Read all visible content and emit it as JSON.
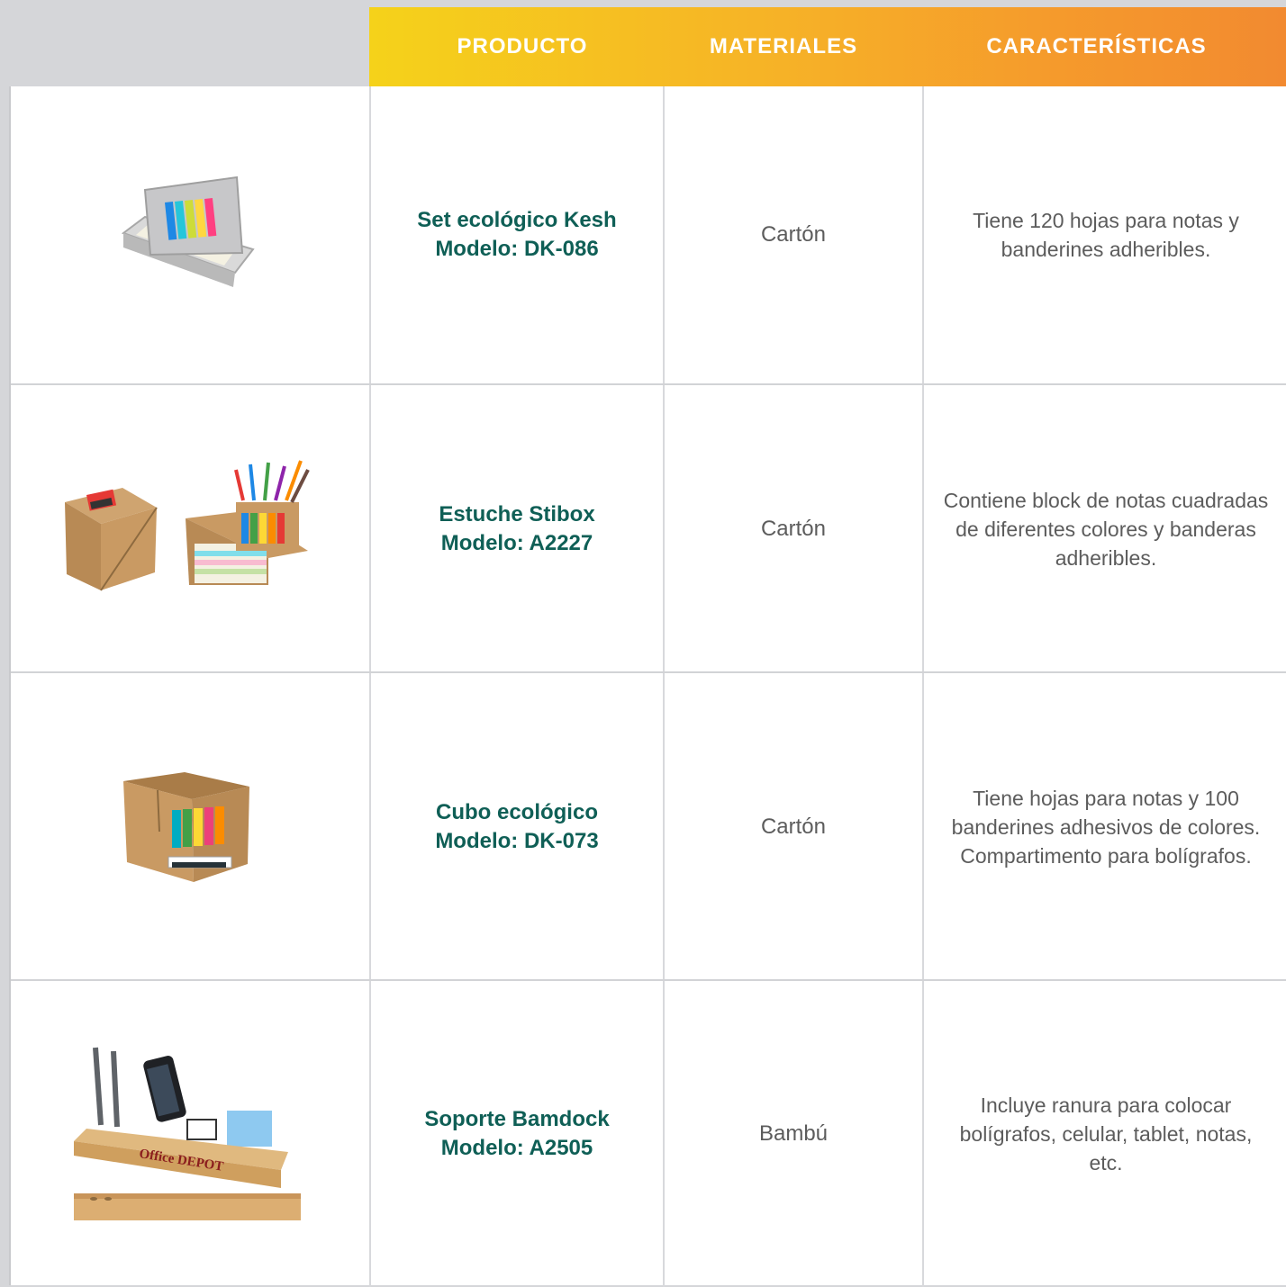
{
  "header": {
    "producto": "PRODUCTO",
    "materiales": "MATERIALES",
    "caracteristicas": "CARACTERÍSTICAS"
  },
  "rows": [
    {
      "name": "Set ecológico Kesh",
      "model": "Modelo: DK-086",
      "material": "Cartón",
      "desc_lines": [
        "Tiene 120 hojas para notas y",
        "banderines adheribles."
      ],
      "image_icon": "sticky-notes-holder-icon"
    },
    {
      "name": "Estuche Stibox",
      "model": "Modelo: A2227",
      "material": "Cartón",
      "desc_lines": [
        "Contiene block de notas cuadradas",
        "de diferentes colores y banderas",
        "adheribles."
      ],
      "image_icon": "cardboard-box-organizer-icon"
    },
    {
      "name": "Cubo ecológico",
      "model": "Modelo: DK-073",
      "material": "Cartón",
      "desc_lines": [
        "Tiene hojas para notas y 100",
        "banderines adhesivos de colores.",
        "Compartimento para bolígrafos."
      ],
      "image_icon": "cardboard-cube-organizer-icon"
    },
    {
      "name": "Soporte Bamdock",
      "model": "Modelo: A2505",
      "material": "Bambú",
      "desc_lines": [
        "Incluye ranura para colocar",
        "bolígrafos, celular, tablet, notas,",
        "etc."
      ],
      "image_icon": "bamboo-desk-stand-icon",
      "image_logo_text": "Office DEPOT"
    }
  ],
  "colors": {
    "header_gradient_start": "#f5d21a",
    "header_gradient_end": "#f28a30",
    "product_name": "#0f5f56",
    "body_text": "#5c5c5c"
  }
}
